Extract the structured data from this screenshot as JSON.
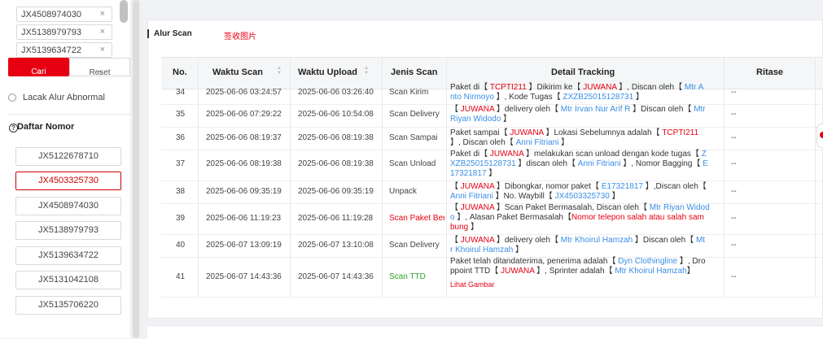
{
  "sidebar": {
    "tags": [
      "JX4508974030",
      "JX5138979793",
      "JX5139634722"
    ],
    "tag_remove": "×",
    "cari": "Cari",
    "reset": "Reset",
    "lacak_alur_abnormal": "Lacak Alur Abnormal",
    "daftar_nomor": "Daftar Nomor",
    "numbers": [
      "JX5122678710",
      "JX4503325730",
      "JX4508974030",
      "JX5138979793",
      "JX5139634722",
      "JX5131042108",
      "JX5135706220"
    ],
    "active_number": "JX4503325730"
  },
  "tabs": {
    "alur_scan": "Alur Scan",
    "foto": "签收图片"
  },
  "table": {
    "headers": {
      "no": "No.",
      "waktu_scan": "Waktu Scan",
      "waktu_upload": "Waktu Upload",
      "jenis_scan": "Jenis Scan",
      "detail": "Detail Tracking",
      "ritase": "Ritase"
    },
    "rows": [
      {
        "no": "34",
        "scan": "2025-06-06 03:24:57",
        "upload": "2025-06-06 03:26:40",
        "jenis": "Scan Kirim",
        "ritase": "--"
      },
      {
        "no": "35",
        "scan": "2025-06-06 07:29:22",
        "upload": "2025-06-06 10:54:08",
        "jenis": "Scan Delivery",
        "ritase": "--"
      },
      {
        "no": "36",
        "scan": "2025-06-06 08:19:37",
        "upload": "2025-06-06 08:19:38",
        "jenis": "Scan Sampai",
        "ritase": "--"
      },
      {
        "no": "37",
        "scan": "2025-06-06 08:19:38",
        "upload": "2025-06-06 08:19:38",
        "jenis": "Scan Unload",
        "ritase": "--"
      },
      {
        "no": "38",
        "scan": "2025-06-06 09:35:19",
        "upload": "2025-06-06 09:35:19",
        "jenis": "Unpack",
        "ritase": "--"
      },
      {
        "no": "39",
        "scan": "2025-06-06 11:19:23",
        "upload": "2025-06-06 11:19:28",
        "jenis": "Scan Paket Ber",
        "ritase": "--"
      },
      {
        "no": "40",
        "scan": "2025-06-07 13:09:19",
        "upload": "2025-06-07 13:10:08",
        "jenis": "Scan Delivery",
        "ritase": "--"
      },
      {
        "no": "41",
        "scan": "2025-06-07 14:43:36",
        "upload": "2025-06-07 14:43:36",
        "jenis": "Scan TTD",
        "ritase": "--"
      }
    ],
    "details": {
      "r34": {
        "l1a": "Paket di【 ",
        "l1b": "TCPTI211",
        "l1c": " 】Dikirim ke【 ",
        "l1d": "JUWANA",
        "l1e": " 】, Discan oleh【 ",
        "l1f": "Mtr A",
        "l2a": "nto Nirmoyo",
        "l2b": " 】, Kode Tugas【 ",
        "l2c": "ZXZB25015128731",
        "l2d": " 】"
      },
      "r35": {
        "a": "【 ",
        "b": "JUWANA",
        "c": " 】delivery oleh【 ",
        "d": "Mtr Irvan Nur Arif R",
        "e": " 】Discan oleh【 ",
        "f": "Mtr",
        "g": "Riyan Widodo",
        "h": " 】"
      },
      "r36": {
        "a": "Paket sampai【 ",
        "b": "JUWANA",
        "c": " 】Lokasi Sebelumnya adalah【 ",
        "d": "TCPTI211",
        "e": "】, Discan oleh【 ",
        "f": "Anni Fitriani",
        "g": " 】"
      },
      "r37": {
        "a": "Paket di【 ",
        "b": "JUWANA",
        "c": " 】melakukan scan unload dengan kode tugas【 ",
        "d": "Z",
        "e": "XZB25015128731",
        "f": " 】discan oleh【 ",
        "g": "Anni Fitriani",
        "h": " 】, Nomor Bagging【 ",
        "i": "E",
        "j": "17321817",
        "k": " 】"
      },
      "r38": {
        "a": "【 ",
        "b": "JUWANA",
        "c": " 】Dibongkar, nomor paket【 ",
        "d": "E17321817",
        "e": " 】,Discan oleh【",
        "f": "Anni Fitriani",
        "g": " 】No. Waybill【 ",
        "h": "JX4503325730",
        "i": " 】"
      },
      "r39": {
        "a": "【 ",
        "b": "JUWANA",
        "c": " 】Scan Paket Bermasalah, Discan oleh【 ",
        "d": "Mtr Riyan Widod",
        "e": "o",
        "f": " 】, Alasan Paket Bermasalah【",
        "g": "Nomor telepon salah atau salah sam",
        "h": "bung",
        "i": " 】"
      },
      "r40": {
        "a": "【 ",
        "b": "JUWANA",
        "c": " 】delivery oleh【 ",
        "d": "Mtr Khoirul Hamzah",
        "e": " 】Discan oleh【 ",
        "f": "Mt",
        "g": "r Khoirul Hamzah",
        "h": " 】"
      },
      "r41": {
        "a": "Paket telah ditandaterima, penerima adalah【 ",
        "b": "Dyn Clothingline",
        "c": " 】, Dro",
        "d": "ppoint TTD【 ",
        "e": "JUWANA",
        "f": " 】, Sprinter adalah【 ",
        "g": "Mtr Khoirul Hamzah",
        "h": "】",
        "i": "Lihat Gambar"
      }
    }
  },
  "colors": {
    "accent": "#e60012",
    "link": "#3a8ee6",
    "success": "#2aa52a"
  }
}
